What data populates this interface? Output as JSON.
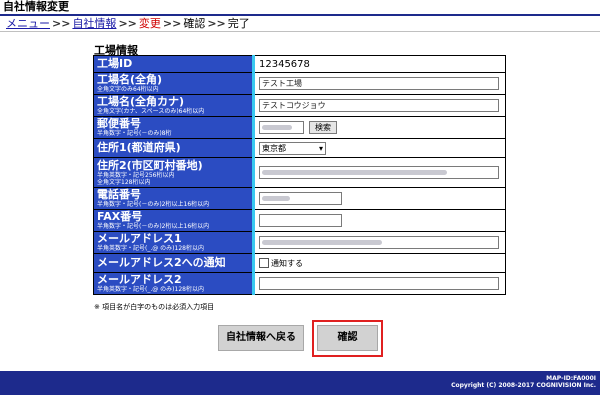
{
  "window": {
    "title": "自社情報変更"
  },
  "breadcrumb": {
    "menu": "メニュー",
    "own_info": "自社情報",
    "change": "変更",
    "confirm": "確認",
    "done": "完了",
    "sep": ">>"
  },
  "section": {
    "title": "工場情報"
  },
  "fields": {
    "factory_id": {
      "label": "工場ID",
      "value": "12345678"
    },
    "factory_name": {
      "label": "工場名(全角)",
      "sub": "全角文字のみ64桁以内",
      "value": "テスト工場"
    },
    "factory_kana": {
      "label": "工場名(全角カナ)",
      "sub": "全角文字(カナ、スペースのみ)64桁以内",
      "value": "テストコウジョウ"
    },
    "postal": {
      "label": "郵便番号",
      "sub": "半角数字・記号(－のみ)8桁",
      "search": "検索"
    },
    "address1": {
      "label": "住所1(都道府県)",
      "value": "東京都"
    },
    "address2": {
      "label": "住所2(市区町村番地)",
      "sub1": "半角英数字・記号256桁以内",
      "sub2": "全角文字128桁以内"
    },
    "phone": {
      "label": "電話番号",
      "sub": "半角数字・記号(－のみ)2桁以上16桁以内"
    },
    "fax": {
      "label": "FAX番号",
      "sub": "半角数字・記号(－のみ)2桁以上16桁以内"
    },
    "email1": {
      "label": "メールアドレス1",
      "sub": "半角英数字・記号(_.@ のみ)128桁以内"
    },
    "email2_notify": {
      "label": "メールアドレス2への通知",
      "checkbox_label": "通知する"
    },
    "email2": {
      "label": "メールアドレス2",
      "sub": "半角英数字・記号(_.@ のみ)128桁以内"
    }
  },
  "note": "※ 項目名が白字のものは必須入力項目",
  "buttons": {
    "back": "自社情報へ戻る",
    "confirm": "確認"
  },
  "footer": {
    "map_id": "MAP-ID:FA000I",
    "copyright": "Copyright (C) 2008-2017 COGNIVISION Inc."
  },
  "colors": {
    "header_blue": "#1d2a8c",
    "label_blue": "#2b4cc2",
    "label_edge": "#39c8f0",
    "current_red": "#d00000",
    "highlight": "#e02020"
  }
}
